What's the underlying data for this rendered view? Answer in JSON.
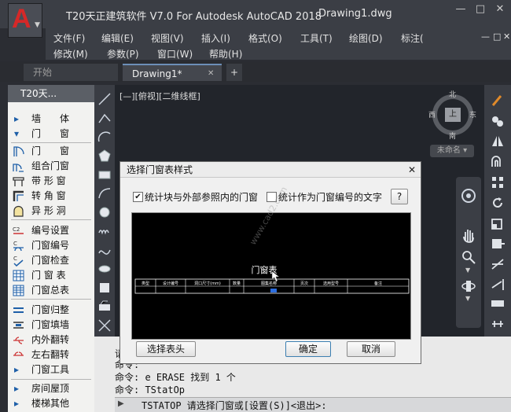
{
  "app": {
    "title": "T20天正建筑软件 V7.0 For Autodesk AutoCAD 2018",
    "document": "Drawing1.dwg",
    "logo_letter": "A",
    "window_buttons": [
      "—",
      "□",
      "✕"
    ],
    "inner_window_buttons": [
      "—",
      "□",
      "✕"
    ]
  },
  "menu": {
    "row1": [
      "文件(F)",
      "编辑(E)",
      "视图(V)",
      "插入(I)",
      "格式(O)",
      "工具(T)",
      "绘图(D)",
      "标注("
    ],
    "row2": [
      "修改(M)",
      "参数(P)",
      "窗口(W)",
      "帮助(H)"
    ]
  },
  "tabs": [
    {
      "label": "开始",
      "active": false
    },
    {
      "label": "Drawing1*",
      "active": true
    }
  ],
  "tab_close": "✕",
  "tab_add": "+",
  "palette": {
    "header": "T20天...",
    "sections": [
      {
        "label": "墙　　体",
        "expand": "▸"
      },
      {
        "label": "门　　窗",
        "expand": "▾"
      }
    ],
    "items": [
      {
        "label": "门　　窗",
        "icon": "door-icon"
      },
      {
        "label": "组合门窗",
        "icon": "combo-door-icon"
      },
      {
        "label": "带 形 窗",
        "icon": "strip-window-icon"
      },
      {
        "label": "转 角 窗",
        "icon": "corner-window-icon"
      },
      {
        "label": "异 形 洞",
        "icon": "odd-hole-icon"
      },
      {
        "label": "编号设置",
        "icon": "number-settings-icon"
      },
      {
        "label": "门窗编号",
        "icon": "door-number-icon"
      },
      {
        "label": "门窗检查",
        "icon": "door-check-icon"
      },
      {
        "label": "门 窗 表",
        "icon": "door-table-icon"
      },
      {
        "label": "门窗总表",
        "icon": "door-total-table-icon"
      },
      {
        "label": "门窗归整",
        "icon": "door-align-icon"
      },
      {
        "label": "门窗填墙",
        "icon": "door-fill-wall-icon"
      },
      {
        "label": "内外翻转",
        "icon": "flip-inout-icon"
      },
      {
        "label": "左右翻转",
        "icon": "flip-lr-icon"
      },
      {
        "label": "门窗工具",
        "icon": "door-tools-icon"
      }
    ],
    "bottom_sections": [
      {
        "label": "房间屋顶",
        "expand": "▸"
      },
      {
        "label": "楼梯其他",
        "expand": "▸"
      }
    ]
  },
  "viewport": {
    "label": "[—][俯视][二维线框]",
    "viewcube": {
      "north": "北",
      "south": "南",
      "east": "东",
      "west": "西",
      "face": "上"
    },
    "wcs": "未命名 ▾"
  },
  "dialog": {
    "title": "选择门窗表样式",
    "close": "✕",
    "checkbox1": {
      "label": "统计块与外部参照内的门窗",
      "checked": true
    },
    "checkbox2": {
      "label": "统计作为门窗编号的文字",
      "checked": false
    },
    "help": "?",
    "preview_title": "门窗表",
    "preview_headers": [
      "类型",
      "设计编号",
      "洞口尺寸(mm)",
      "数量",
      "图集名称",
      "页次",
      "选用型号",
      "备注"
    ],
    "btn_select_header": "选择表头",
    "btn_ok": "确定",
    "btn_cancel": "取消"
  },
  "command": {
    "history": [
      "请",
      "命令:",
      "命令: e ERASE 找到 1 个",
      "命令: TStatOp"
    ],
    "prompt_icon": "▶",
    "prompt": "TSTATOP 请选择门窗或[设置(S)]<退出>:"
  },
  "watermark": "www.cad2.com",
  "colors": {
    "logo_red": "#d62828",
    "accent_blue": "#3c7fb1",
    "dark_bg": "#22252b"
  }
}
